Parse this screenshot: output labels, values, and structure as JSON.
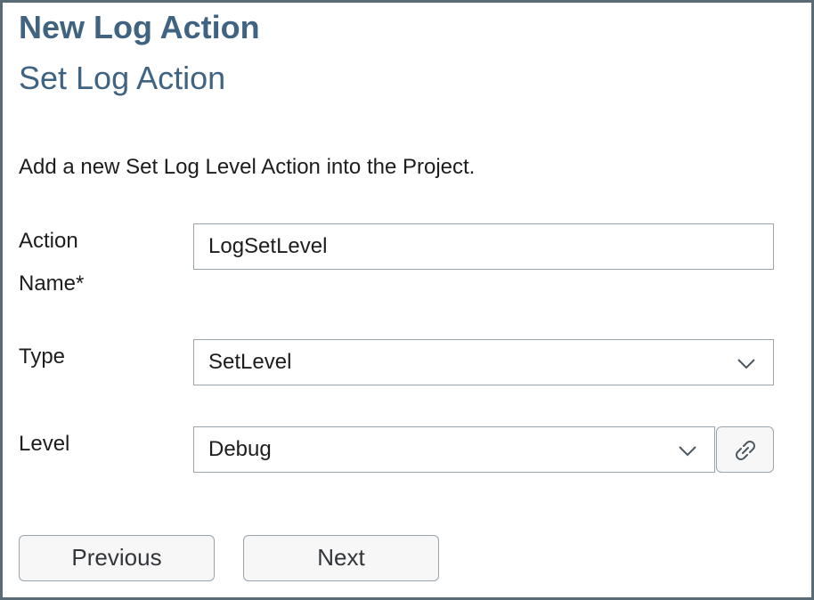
{
  "dialog": {
    "title": "New Log Action",
    "subtitle": "Set Log Action",
    "description": "Add a new Set Log Level Action into the Project."
  },
  "form": {
    "action_name": {
      "label": "Action Name*",
      "value": "LogSetLevel"
    },
    "type": {
      "label": "Type",
      "value": "SetLevel",
      "icon": "chevron-down-icon"
    },
    "level": {
      "label": "Level",
      "value": "Debug",
      "icon": "chevron-down-icon",
      "link_icon": "link-icon"
    }
  },
  "buttons": {
    "previous": "Previous",
    "next": "Next"
  },
  "colors": {
    "title": "#3f6381",
    "border": "#5a6b78",
    "input_border": "#9aa4ad"
  }
}
